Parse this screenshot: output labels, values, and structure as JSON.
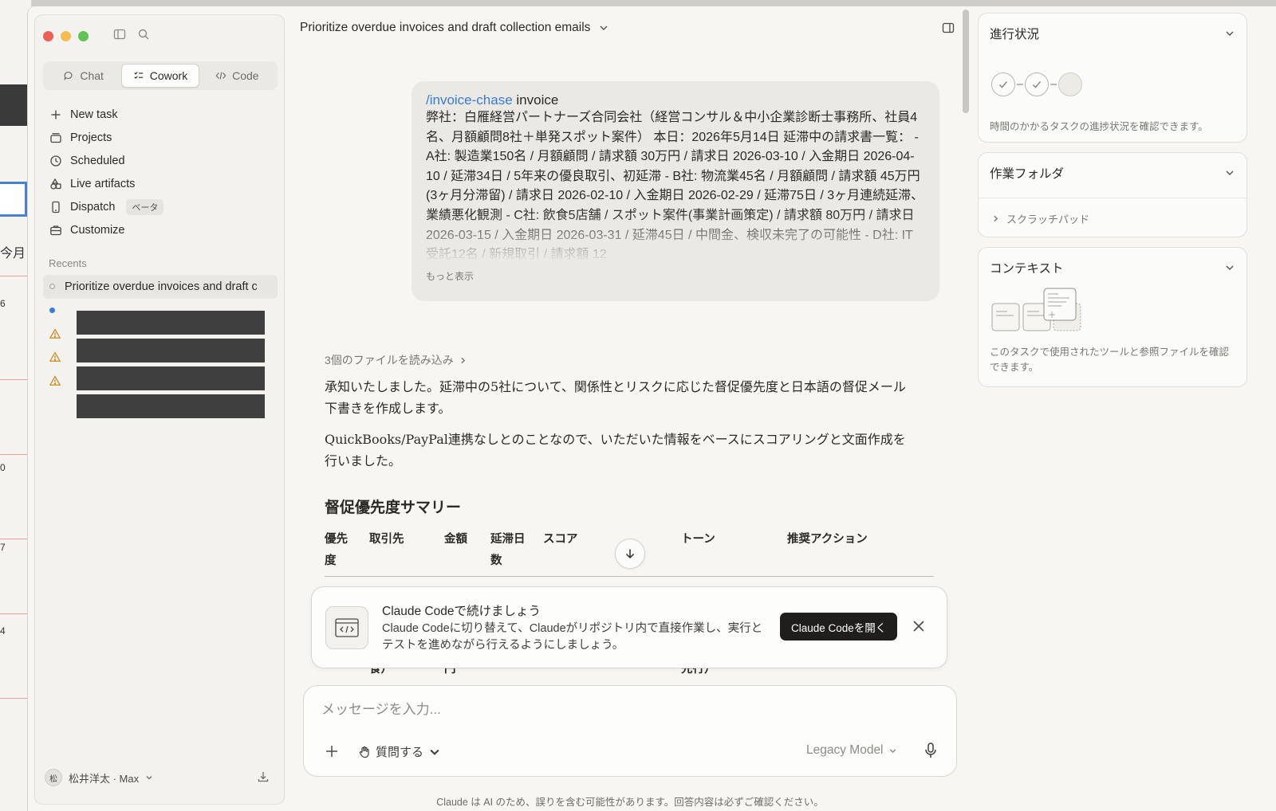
{
  "background_app": {
    "labels": [
      "今月",
      "6",
      "0",
      "7",
      "4"
    ]
  },
  "sidebar": {
    "mode_tabs": [
      {
        "label": "Chat",
        "icon": "chat-bubble-icon",
        "active": false
      },
      {
        "label": "Cowork",
        "icon": "cowork-icon",
        "active": true
      },
      {
        "label": "Code",
        "icon": "code-icon",
        "active": false
      }
    ],
    "nav": [
      {
        "label": "New task",
        "icon": "plus-icon"
      },
      {
        "label": "Projects",
        "icon": "projects-icon"
      },
      {
        "label": "Scheduled",
        "icon": "clock-icon"
      },
      {
        "label": "Live artifacts",
        "icon": "artifacts-icon"
      },
      {
        "label": "Dispatch",
        "icon": "phone-icon",
        "badge": "ベータ"
      },
      {
        "label": "Customize",
        "icon": "briefcase-icon"
      }
    ],
    "recents_label": "Recents",
    "recents": [
      {
        "label": "Prioritize overdue invoices and draft c",
        "status": "active"
      }
    ],
    "user": {
      "avatar": "松",
      "name": "松井洋太 · Max"
    }
  },
  "main": {
    "chat_title": "Prioritize overdue invoices and draft collection emails",
    "user_message": {
      "slash": "/invoice-chase",
      "arg": " invoice",
      "body": "弊社：白雁経営パートナーズ合同会社（経営コンサル＆中小企業診断士事務所、社員4名、月額顧問8社＋単発スポット案件） 本日：2026年5月14日 延滞中の請求書一覧： - A社: 製造業150名 / 月額顧問 / 請求額 30万円 / 請求日 2026-03-10 / 入金期日 2026-04-10 / 延滞34日 / 5年来の優良取引、初延滞 - B社: 物流業45名 / 月額顧問 / 請求額 45万円(3ヶ月分滞留) / 請求日 2026-02-10 / 入金期日 2026-02-29 / 延滞75日 / 3ヶ月連続延滞、業績悪化観測 - C社: 飲食5店舗 / スポット案件(事業計画策定) / 請求額 80万円 / 請求日 2026-03-15 / 入金期日 2026-03-31 / 延滞45日 / 中間金、検収未完了の可能性 - D社: IT受託12名 / 新規取引 / 請求額 12",
      "more": "もっと表示"
    },
    "files_read": "3個のファイルを読み込み",
    "paragraphs": [
      "承知いたしました。延滞中の5社について、関係性とリスクに応じた督促優先度と日本語の督促メール下書きを作成します。",
      "QuickBooks/PayPal連携なしとのことなので、いただいた情報をベースにスコアリングと文面作成を行いました。"
    ],
    "section_heading": "督促優先度サマリー",
    "table_headers": [
      "優先度",
      "取引先",
      "金額",
      "延滞日数",
      "スコア",
      "トーン",
      "推奨アクション"
    ],
    "table_peek": [
      "食）",
      "円",
      "先行）"
    ],
    "claude_code_card": {
      "title": "Claude Codeで続けましょう",
      "description": "Claude Codeに切り替えて、Claudeがリポジトリ内で直接作業し、実行とテストを進めながら行えるようにしましょう。",
      "button": "Claude Codeを開く"
    },
    "composer": {
      "placeholder": "メッセージを入力...",
      "ask_label": "質問する",
      "model_label": "Legacy Model"
    },
    "disclaimer": "Claude は AI のため、誤りを含む可能性があります。回答内容は必ずご確認ください。"
  },
  "right_panel": {
    "progress": {
      "title": "進行状況",
      "steps": [
        "done",
        "done",
        "pending"
      ],
      "description": "時間のかかるタスクの進捗状況を確認できます。"
    },
    "folder": {
      "title": "作業フォルダ",
      "item": "スクラッチパッド"
    },
    "context": {
      "title": "コンテキスト",
      "description": "このタスクで使用されたツールと参照ファイルを確認できます。"
    }
  }
}
